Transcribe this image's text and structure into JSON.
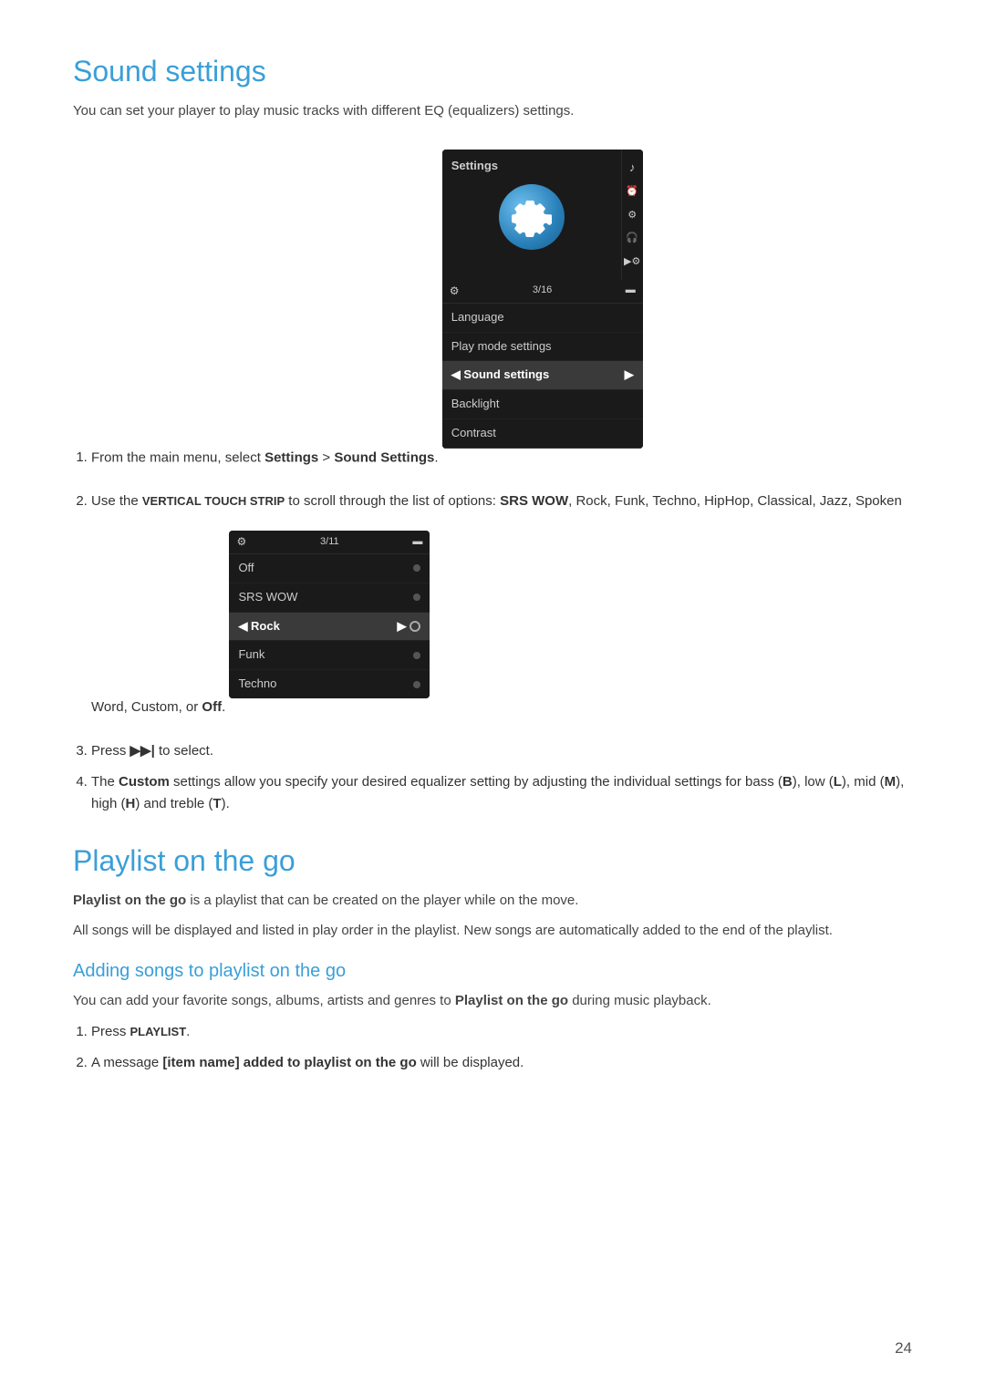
{
  "page": {
    "number": "24"
  },
  "sound_settings": {
    "title": "Sound settings",
    "intro": "You can set your player to play music tracks with different EQ (equalizers) settings.",
    "step1": {
      "text": "From the main menu, select ",
      "bold1": "Settings",
      "arrow": " > ",
      "bold2": "Sound Settings",
      "dot": "."
    },
    "settings_menu": {
      "header": "Settings",
      "topbar_gear": "⚙",
      "topbar_counter": "3/16",
      "topbar_battery": "▬",
      "items": [
        {
          "label": "Language",
          "type": "normal"
        },
        {
          "label": "Play mode settings",
          "type": "normal"
        },
        {
          "label": "◄ Sound settings",
          "arrow": "►",
          "type": "highlighted"
        },
        {
          "label": "Backlight",
          "type": "normal"
        },
        {
          "label": "Contrast",
          "type": "normal"
        }
      ]
    },
    "step2": {
      "prefix": "Use the ",
      "smallcaps": "VERTICAL TOUCH STRIP",
      "mid": " to scroll through the list of options: ",
      "options": "SRS WOW, Rock, Funk, Techno, HipHop, Classical, Jazz, Spoken Word, Custom, or Off."
    },
    "eq_menu": {
      "topbar_gear": "⚙",
      "topbar_counter": "3/11",
      "topbar_battery": "▬",
      "items": [
        {
          "label": "Off",
          "type": "dot"
        },
        {
          "label": "SRS WOW",
          "type": "dot"
        },
        {
          "label": "◄ Rock",
          "arrow": "►○",
          "type": "active"
        },
        {
          "label": "Funk",
          "type": "dot"
        },
        {
          "label": "Techno",
          "type": "dot"
        }
      ]
    },
    "step3": {
      "text": "Press ",
      "symbol": "▶▶|",
      "suffix": " to select."
    },
    "step4": {
      "prefix": "The ",
      "bold": "Custom",
      "suffix": " settings allow you specify your desired equalizer setting by adjusting the individual settings for bass (",
      "b": "B",
      "close1": "), low (",
      "l": "L",
      "close2": "), mid (",
      "m": "M",
      "close3": "), high (",
      "h": "H",
      "close4": ") and treble (",
      "t": "T",
      "close5": ")."
    }
  },
  "playlist": {
    "title": "Playlist on the go",
    "intro1": "Playlist on the go is a playlist that can be created on the player while on the move.",
    "intro2": "All songs will be displayed and listed in play order in the playlist. New songs are automatically added to the end of the playlist.",
    "adding": {
      "title": "Adding songs to playlist on the go",
      "intro": "You can add your favorite songs, albums, artists and genres to ",
      "bold": "Playlist on the go",
      "suffix": " during music playback.",
      "step1_text": "Press ",
      "step1_smallcaps": "PLAYLIST",
      "step1_end": ".",
      "step2_text": "A message ",
      "step2_bold": "[item name] added to playlist on the go",
      "step2_end": " will be displayed."
    }
  }
}
